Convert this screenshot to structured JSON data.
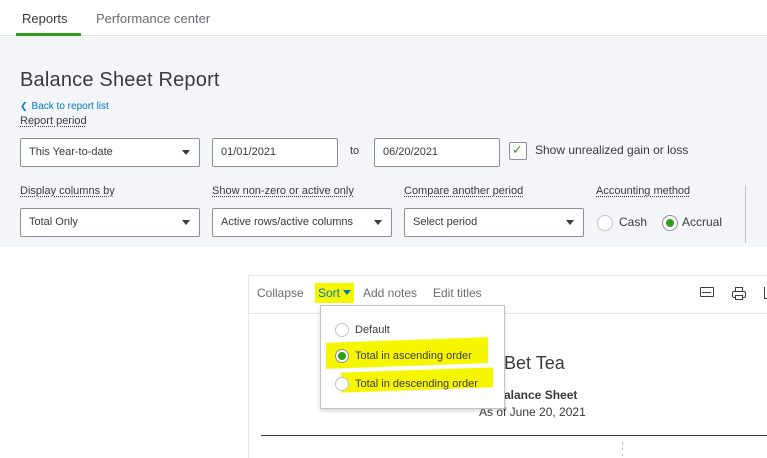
{
  "tabs": [
    {
      "label": "Reports",
      "active": true
    },
    {
      "label": "Performance center",
      "active": false
    }
  ],
  "header": {
    "title": "Balance Sheet Report",
    "back_link": "Back to report list",
    "report_period_label": "Report period",
    "report_period_value": "This Year-to-date",
    "date_from": "01/01/2021",
    "to_label": "to",
    "date_to": "06/20/2021",
    "show_unrealized_label": "Show unrealized gain or loss",
    "show_unrealized_checked": true,
    "display_columns_label": "Display columns by",
    "display_columns_value": "Total Only",
    "non_zero_label": "Show non-zero or active only",
    "non_zero_value": "Active rows/active columns",
    "compare_label": "Compare another period",
    "compare_placeholder": "Select period",
    "accounting_method_label": "Accounting method",
    "method_options": [
      {
        "label": "Cash",
        "selected": false
      },
      {
        "label": "Accrual",
        "selected": true
      }
    ]
  },
  "report_toolbar": {
    "collapse": "Collapse",
    "sort": "Sort",
    "add_notes": "Add notes",
    "edit_titles": "Edit titles",
    "icons": [
      "mail-icon",
      "print-icon",
      "export-icon"
    ]
  },
  "report": {
    "company": "Bet Tea",
    "sheet_title": "alance Sheet",
    "as_of": "As of June 20, 2021"
  },
  "sort_menu": {
    "options": [
      {
        "label": "Default",
        "selected": false
      },
      {
        "label": "Total in ascending order",
        "selected": true
      },
      {
        "label": "Total in descending order",
        "selected": false
      }
    ]
  },
  "colors": {
    "accent_green": "#2ca01c",
    "link_blue": "#0077c5",
    "highlight_yellow": "#f6f600",
    "header_bg": "#f4f5f8"
  }
}
